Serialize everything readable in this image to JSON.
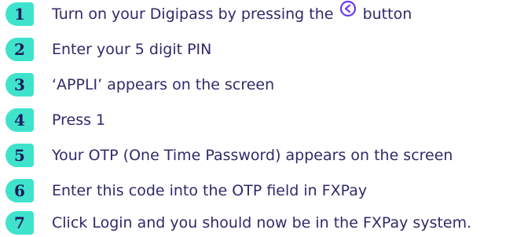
{
  "steps": [
    {
      "number": "1",
      "text_before": "Turn on your Digipass by pressing the",
      "icon": "back-arrow-circle-icon",
      "text_after": "button"
    },
    {
      "number": "2",
      "text": "Enter your 5 digit PIN"
    },
    {
      "number": "3",
      "text": "‘APPLI’ appears on the screen"
    },
    {
      "number": "4",
      "text": "Press 1"
    },
    {
      "number": "5",
      "text": "Your OTP (One Time Password) appears on the screen"
    },
    {
      "number": "6",
      "text": "Enter this code into the OTP field in FXPay"
    },
    {
      "number": "7",
      "text": "Click Login and you should now be in the FXPay system."
    }
  ],
  "colors": {
    "badge": "#3fe3cc",
    "number": "#1d1a5c",
    "text": "#2f2a6a",
    "icon": "#6b3df0"
  }
}
